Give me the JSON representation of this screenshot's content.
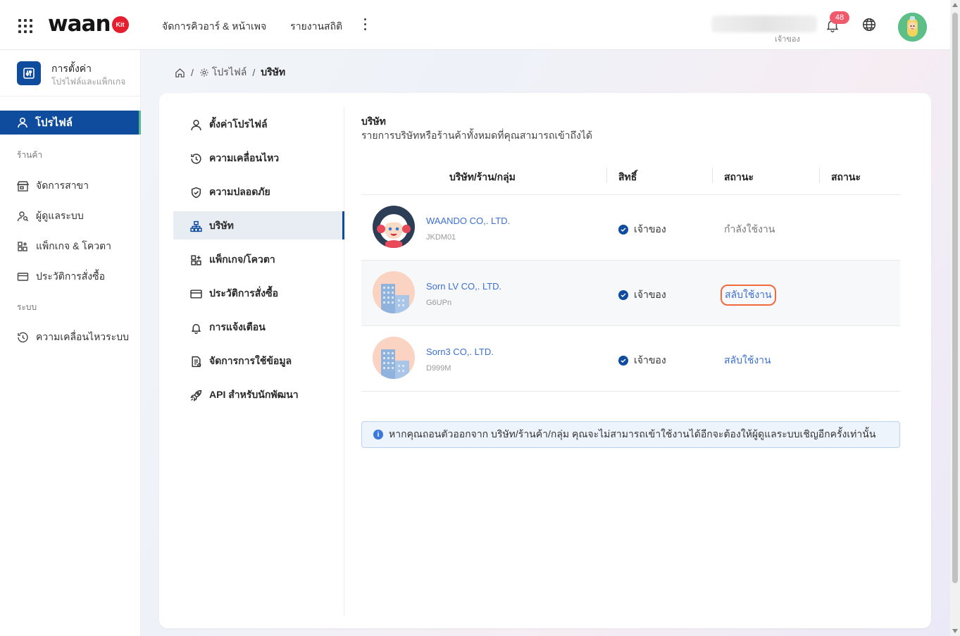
{
  "header": {
    "logo_text": "waan",
    "logo_badge": "Kit",
    "nav": [
      "จัดการคิวอาร์ & หน้าเพจ",
      "รายงานสถิติ"
    ],
    "user_role": "เจ้าของ",
    "notification_count": "48"
  },
  "sidebar": {
    "title": "การตั้งค่า",
    "subtitle": "โปรไฟล์และแพ็กเกจ",
    "active": "โปรไฟล์",
    "section_shop": "ร้านค้า",
    "shop_items": [
      "จัดการสาขา",
      "ผู้ดูแลระบบ",
      "แพ็กเกจ & โควตา",
      "ประวัติการสั่งซื้อ"
    ],
    "section_system": "ระบบ",
    "system_items": [
      "ความเคลื่อนไหวระบบ"
    ]
  },
  "breadcrumb": {
    "profile": "โปรไฟล์",
    "current": "บริษัท"
  },
  "submenu": [
    {
      "label": "ตั้งค่าโปรไฟล์",
      "icon": "user-icon"
    },
    {
      "label": "ความเคลื่อนไหว",
      "icon": "clock-icon"
    },
    {
      "label": "ความปลอดภัย",
      "icon": "shield-icon"
    },
    {
      "label": "บริษัท",
      "icon": "org-icon"
    },
    {
      "label": "แพ็กเกจ/โควตา",
      "icon": "grid-icon"
    },
    {
      "label": "ประวัติการสั่งซื้อ",
      "icon": "card-icon"
    },
    {
      "label": "การแจ้งเตือน",
      "icon": "bell-icon"
    },
    {
      "label": "จัดการการใช้ข้อมูล",
      "icon": "document-icon"
    },
    {
      "label": "API สำหรับนักพัฒนา",
      "icon": "rocket-icon"
    }
  ],
  "company": {
    "title": "บริษัท",
    "description": "รายการบริษัทหรือร้านค้าทั้งหมดที่คุณสามารถเข้าถึงได้",
    "columns": [
      "บริษัท/ร้าน/กลุ่ม",
      "สิทธิ์",
      "สถานะ",
      "สถานะ"
    ],
    "rows": [
      {
        "name": "WAANDO CO,. LTD.",
        "code": "JKDM01",
        "role": "เจ้าของ",
        "status": "กำลังใช้งาน",
        "status_type": "current"
      },
      {
        "name": "Sorn LV CO,. LTD.",
        "code": "G6UPn",
        "role": "เจ้าของ",
        "status": "สลับใช้งาน",
        "status_type": "link-highlight"
      },
      {
        "name": "Sorn3 CO,. LTD.",
        "code": "D999M",
        "role": "เจ้าของ",
        "status": "สลับใช้งาน",
        "status_type": "link"
      }
    ],
    "info": "หากคุณถอนตัวออกจาก บริษัท/ร้านค้า/กลุ่ม คุณจะไม่สามารถเข้าใช้งานได้อีกจะต้องให้ผู้ดูแลระบบเชิญอีกครั้งเท่านั้น"
  },
  "colors": {
    "brand": "#0f4c9e",
    "link": "#3c6fd1",
    "highlight_ring": "#f06a3e",
    "badge": "#ef5b6c"
  }
}
